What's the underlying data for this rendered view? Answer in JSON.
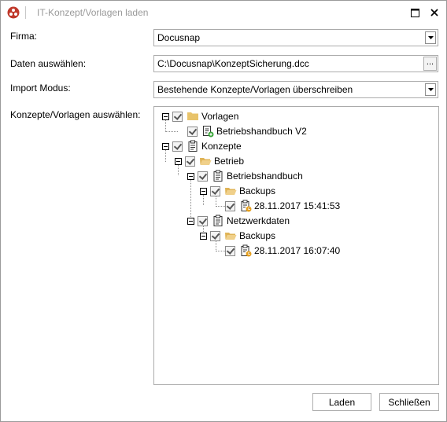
{
  "window": {
    "title": "IT-Konzept/Vorlagen laden"
  },
  "form": {
    "firma_label": "Firma:",
    "firma_value": "Docusnap",
    "daten_label": "Daten auswählen:",
    "daten_value": "C:\\Docusnap\\KonzeptSicherung.dcc",
    "browse_label": "...",
    "import_label": "Import Modus:",
    "import_value": "Bestehende Konzepte/Vorlagen überschreiben",
    "tree_label": "Konzepte/Vorlagen auswählen:"
  },
  "tree": {
    "vorlagen": "Vorlagen",
    "betriebshandbuch_v2": "Betriebshandbuch V2",
    "konzepte": "Konzepte",
    "betrieb": "Betrieb",
    "betriebshandbuch": "Betriebshandbuch",
    "backups_1": "Backups",
    "backup_date_1": "28.11.2017 15:41:53",
    "netzwerkdaten": "Netzwerkdaten",
    "backups_2": "Backups",
    "backup_date_2": "28.11.2017 16:07:40"
  },
  "buttons": {
    "laden": "Laden",
    "schliessen": "Schließen"
  },
  "colors": {
    "folder": "#e8c36a",
    "badge_green": "#3aa63a",
    "badge_orange": "#e5a020",
    "app_icon": "#c0392b"
  },
  "icons": [
    "app-logo-icon",
    "maximize-icon",
    "close-icon",
    "dropdown-arrow-icon",
    "folder-icon",
    "document-icon",
    "clipboard-icon",
    "folder-open-icon",
    "backup-document-icon"
  ]
}
